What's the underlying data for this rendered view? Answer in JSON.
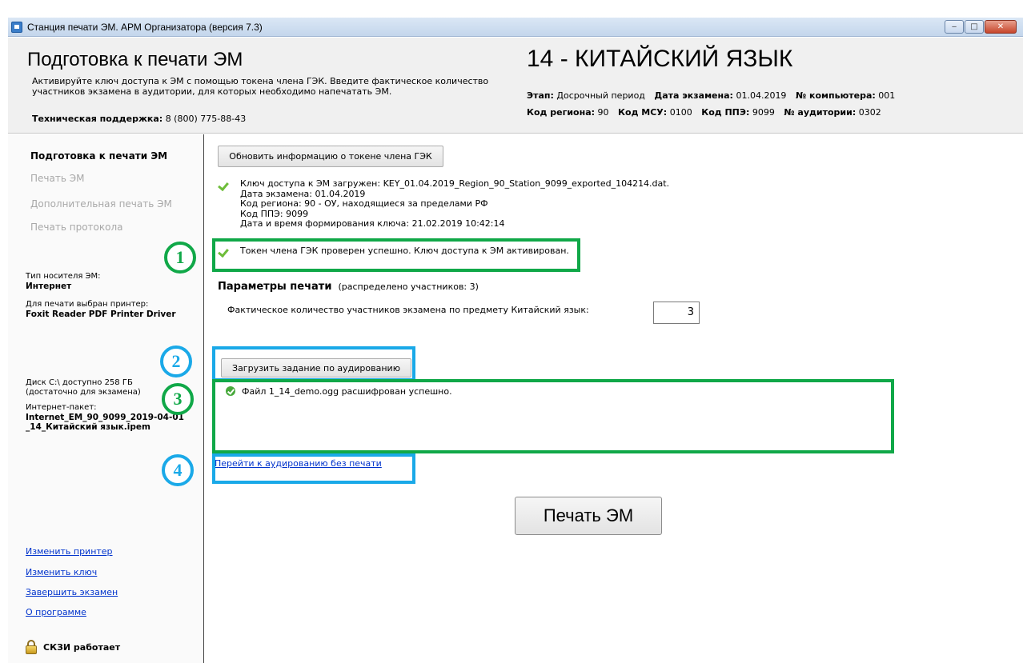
{
  "window": {
    "title": "Станция печати ЭМ. АРМ Организатора (версия 7.3)",
    "buttons": {
      "minimize": "‒",
      "maximize": "□",
      "close": "✕"
    }
  },
  "header": {
    "title": "Подготовка к печати ЭМ",
    "description": "Активируйте ключ доступа к ЭМ с помощью токена члена ГЭК. Введите фактическое количество участников экзамена в аудитории, для которых необходимо напечатать ЭМ.",
    "support_label": "Техническая поддержка:",
    "support_phone": "8 (800) 775-88-43",
    "subject": "14 - КИТАЙСКИЙ ЯЗЫК",
    "meta": {
      "stage_label": "Этап:",
      "stage_value": "Досрочный период",
      "exam_date_label": "Дата экзамена:",
      "exam_date_value": "01.04.2019",
      "computer_label": "№ компьютера:",
      "computer_value": "001",
      "region_label": "Код региона:",
      "region_value": "90",
      "msu_label": "Код МСУ:",
      "msu_value": "0100",
      "ppe_label": "Код ППЭ:",
      "ppe_value": "9099",
      "room_label": "№ аудитории:",
      "room_value": "0302"
    }
  },
  "sidebar": {
    "nav": [
      {
        "label": "Подготовка к печати ЭМ",
        "active": true
      },
      {
        "label": "Печать ЭМ",
        "active": false
      },
      {
        "label": "Дополнительная печать ЭМ",
        "active": false
      },
      {
        "label": "Печать протокола",
        "active": false
      }
    ],
    "media_type_label": "Тип носителя ЭМ:",
    "media_type_value": "Интернет",
    "printer_label": "Для печати выбран принтер:",
    "printer_value": "Foxit Reader PDF Printer Driver",
    "disk_line1": "Диск C:\\ доступно 258 ГБ",
    "disk_line2": "(достаточно для экзамена)",
    "package_label": "Интернет-пакет:",
    "package_value_line1": "Internet_EM_90_9099_2019-04-01",
    "package_value_line2": "_14_Китайский язык.ipem",
    "links": {
      "change_printer": "Изменить принтер",
      "change_key": "Изменить ключ",
      "finish_exam": "Завершить экзамен",
      "about": "О программе"
    },
    "skzi_status": "СКЗИ работает"
  },
  "main": {
    "refresh_token_button": "Обновить информацию о токене члена ГЭК",
    "key_info": {
      "loaded": "Ключ доступа к ЭМ загружен: KEY_01.04.2019_Region_90_Station_9099_exported_104214.dat.",
      "exam_date": "Дата экзамена: 01.04.2019",
      "region": "Код региона: 90 - ОУ, находящиеся за пределами РФ",
      "ppe": "Код ППЭ: 9099",
      "created": "Дата и время формирования ключа: 21.02.2019 10:42:14"
    },
    "token_status": "Токен члена ГЭК проверен успешно. Ключ доступа к ЭМ активирован.",
    "print_params_title": "Параметры печати",
    "print_params_distributed": "(распределено участников: 3)",
    "participants_label": "Фактическое количество участников экзамена по предмету Китайский язык:",
    "participants_value": "3",
    "load_audio_button": "Загрузить задание по аудированию",
    "log_message": "Файл 1_14_demo.ogg расшифрован успешно.",
    "listen_link": "Перейти к аудированию без печати",
    "print_button": "Печать ЭМ"
  },
  "annotations": [
    {
      "number": "1",
      "color": "#10a848"
    },
    {
      "number": "2",
      "color": "#1aa9e8"
    },
    {
      "number": "3",
      "color": "#10a848"
    },
    {
      "number": "4",
      "color": "#1aa9e8"
    }
  ]
}
